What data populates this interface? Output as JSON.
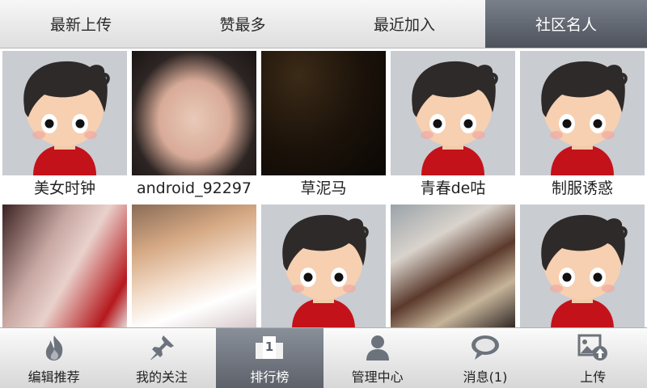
{
  "top_tabs": [
    {
      "label": "最新上传",
      "active": false
    },
    {
      "label": "赞最多",
      "active": false
    },
    {
      "label": "最近加入",
      "active": false
    },
    {
      "label": "社区名人",
      "active": true
    }
  ],
  "grid": {
    "row1": [
      {
        "caption": "美女时钟",
        "image": "default-avatar"
      },
      {
        "caption": "android_92297",
        "image": "photo"
      },
      {
        "caption": "草泥马",
        "image": "photo"
      },
      {
        "caption": "青春de咕",
        "image": "default-avatar"
      },
      {
        "caption": "制服诱惑",
        "image": "default-avatar"
      }
    ],
    "row2": [
      {
        "caption": "",
        "image": "photo"
      },
      {
        "caption": "",
        "image": "photo"
      },
      {
        "caption": "",
        "image": "default-avatar"
      },
      {
        "caption": "",
        "image": "photo"
      },
      {
        "caption": "",
        "image": "default-avatar"
      }
    ]
  },
  "bottom_nav": [
    {
      "label": "编辑推荐",
      "icon": "flame-icon",
      "active": false
    },
    {
      "label": "我的关注",
      "icon": "pin-icon",
      "active": false
    },
    {
      "label": "排行榜",
      "icon": "rank-icon",
      "icon_text": "1",
      "active": true
    },
    {
      "label": "管理中心",
      "icon": "user-icon",
      "active": false
    },
    {
      "label": "消息(1)",
      "icon": "chat-bubble-icon",
      "active": false
    },
    {
      "label": "上传",
      "icon": "upload-photo-icon",
      "active": false
    }
  ],
  "colors": {
    "active_tab": "#5a5f68",
    "avatar_bg": "#c9ccd1",
    "avatar_shirt": "#c4121a"
  }
}
